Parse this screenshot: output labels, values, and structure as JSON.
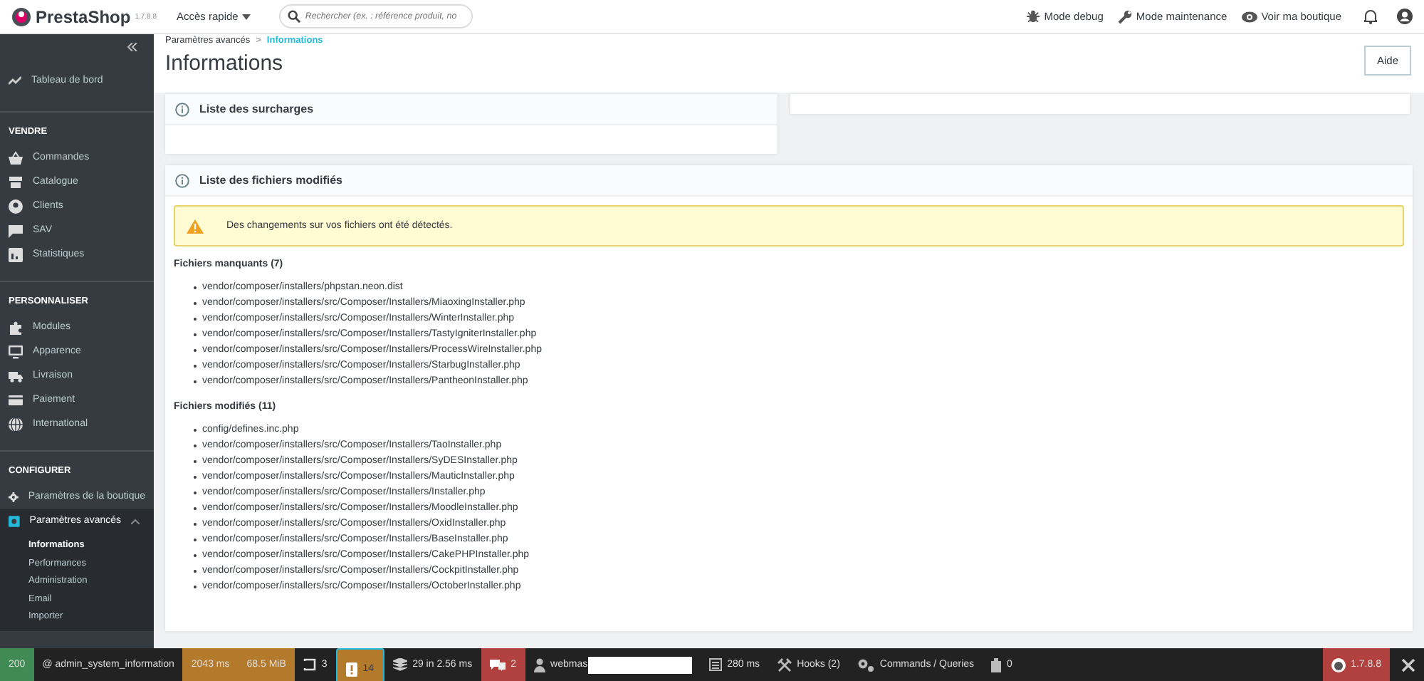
{
  "topbar": {
    "logo": "PrestaShop",
    "version": "1.7.8.8",
    "quick_access": "Accès rapide",
    "search": {
      "placeholder": "Rechercher (ex. : référence produit, no"
    },
    "actions": [
      {
        "label": "Mode debug",
        "kind": "bug"
      },
      {
        "label": "Mode maintenance",
        "kind": "wrench"
      },
      {
        "label": "Voir ma boutique",
        "kind": "eye"
      }
    ]
  },
  "sidebar": {
    "dashboard": {
      "label": "Tableau de bord"
    },
    "sections": [
      {
        "title": "VENDRE",
        "items": [
          {
            "label": "Commandes",
            "kind": "basket",
            "selected": false
          },
          {
            "label": "Catalogue",
            "kind": "store",
            "selected": false
          },
          {
            "label": "Clients",
            "kind": "person",
            "selected": false
          },
          {
            "label": "SAV",
            "kind": "chat",
            "selected": false
          },
          {
            "label": "Statistiques",
            "kind": "chart",
            "selected": false
          }
        ]
      },
      {
        "title": "PERSONNALISER",
        "items": [
          {
            "label": "Modules",
            "kind": "puzzle",
            "selected": false
          },
          {
            "label": "Apparence",
            "kind": "monitor",
            "selected": false
          },
          {
            "label": "Livraison",
            "kind": "truck",
            "selected": false
          },
          {
            "label": "Paiement",
            "kind": "card",
            "selected": false
          },
          {
            "label": "International",
            "kind": "globe",
            "selected": false
          }
        ]
      },
      {
        "title": "CONFIGURER",
        "items": [
          {
            "label": "Paramètres de la boutique",
            "kind": "gear",
            "selected": false
          },
          {
            "label": "Paramètres avancés",
            "kind": "cogbox",
            "selected": true,
            "expanded": true,
            "children": [
              {
                "label": "Informations",
                "selected": true
              },
              {
                "label": "Performances",
                "selected": false
              },
              {
                "label": "Administration",
                "selected": false
              },
              {
                "label": "Email",
                "selected": false
              },
              {
                "label": "Importer",
                "selected": false
              }
            ]
          }
        ]
      }
    ]
  },
  "breadcrumb": {
    "separator": ">",
    "items": [
      {
        "label": "Paramètres avancés",
        "selected": false
      },
      {
        "label": "Informations",
        "selected": true
      }
    ]
  },
  "title": "Informations",
  "help_button": "Aide",
  "overrides_card": {
    "title": "Liste des surcharges"
  },
  "modified_card": {
    "title": "Liste des fichiers modifiés",
    "alert": {
      "kind": "warning",
      "text": "Des changements sur vos fichiers ont été détectés."
    },
    "groups": [
      {
        "heading": "Fichiers manquants (7)",
        "files": [
          "vendor/composer/installers/phpstan.neon.dist",
          "vendor/composer/installers/src/Composer/Installers/MiaoxingInstaller.php",
          "vendor/composer/installers/src/Composer/Installers/WinterInstaller.php",
          "vendor/composer/installers/src/Composer/Installers/TastyIgniterInstaller.php",
          "vendor/composer/installers/src/Composer/Installers/ProcessWireInstaller.php",
          "vendor/composer/installers/src/Composer/Installers/StarbugInstaller.php",
          "vendor/composer/installers/src/Composer/Installers/PantheonInstaller.php"
        ]
      },
      {
        "heading": "Fichiers modifiés (11)",
        "files": [
          "config/defines.inc.php",
          "vendor/composer/installers/src/Composer/Installers/TaoInstaller.php",
          "vendor/composer/installers/src/Composer/Installers/SyDESInstaller.php",
          "vendor/composer/installers/src/Composer/Installers/MauticInstaller.php",
          "vendor/composer/installers/src/Composer/Installers/Installer.php",
          "vendor/composer/installers/src/Composer/Installers/MoodleInstaller.php",
          "vendor/composer/installers/src/Composer/Installers/OxidInstaller.php",
          "vendor/composer/installers/src/Composer/Installers/BaseInstaller.php",
          "vendor/composer/installers/src/Composer/Installers/CakePHPInstaller.php",
          "vendor/composer/installers/src/Composer/Installers/CockpitInstaller.php",
          "vendor/composer/installers/src/Composer/Installers/OctoberInstaller.php"
        ]
      }
    ]
  },
  "debug_bar": {
    "items": [
      {
        "kind": "status",
        "text": "200",
        "color": "#3f8a55"
      },
      {
        "kind": "route",
        "text": "@ admin_system_information"
      },
      {
        "kind": "plain",
        "text": "2043 ms",
        "color": "#b37a2c"
      },
      {
        "kind": "plain",
        "text": "68.5 MiB",
        "color": "#b37a2c"
      },
      {
        "kind": "form",
        "text": "3"
      },
      {
        "kind": "alert",
        "text": "14",
        "color": "#b37a2c"
      },
      {
        "kind": "db",
        "text": "29 in 2.56 ms"
      },
      {
        "kind": "security",
        "text": "2",
        "color": "#b0413e"
      },
      {
        "kind": "user",
        "text": "webmas"
      },
      {
        "kind": "twig",
        "text": "280 ms"
      },
      {
        "kind": "hooks",
        "text": "Hooks (2)"
      },
      {
        "kind": "gears",
        "text": "Commands / Queries"
      },
      {
        "kind": "cache",
        "text": "0"
      }
    ],
    "version": {
      "text": "1.7.8.8",
      "color": "#b0413e"
    }
  }
}
